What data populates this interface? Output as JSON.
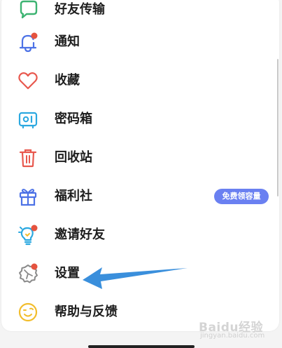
{
  "menu": {
    "items": [
      {
        "label": "好友传输",
        "icon": "chat-bubble-icon"
      },
      {
        "label": "通知",
        "icon": "bell-icon"
      },
      {
        "label": "收藏",
        "icon": "heart-icon"
      },
      {
        "label": "密码箱",
        "icon": "safe-icon"
      },
      {
        "label": "回收站",
        "icon": "trash-icon"
      },
      {
        "label": "福利社",
        "icon": "gift-icon",
        "badge": "免费领容量"
      },
      {
        "label": "邀请好友",
        "icon": "lightbulb-icon"
      },
      {
        "label": "设置",
        "icon": "gear-icon"
      },
      {
        "label": "帮助与反馈",
        "icon": "smiley-icon"
      }
    ]
  },
  "watermark": {
    "logo": "Baidu经验",
    "url": "jingyan.baidu.com"
  },
  "colors": {
    "icon_blue": "#4d72e6",
    "icon_red": "#e8584e",
    "icon_cyan": "#2ba8e0",
    "icon_yellow": "#f2bd2c",
    "icon_gray": "#8a8a8a",
    "notification_dot": "#e5533f",
    "badge_bg": "#6a80f1",
    "arrow": "#3a8fdc"
  }
}
